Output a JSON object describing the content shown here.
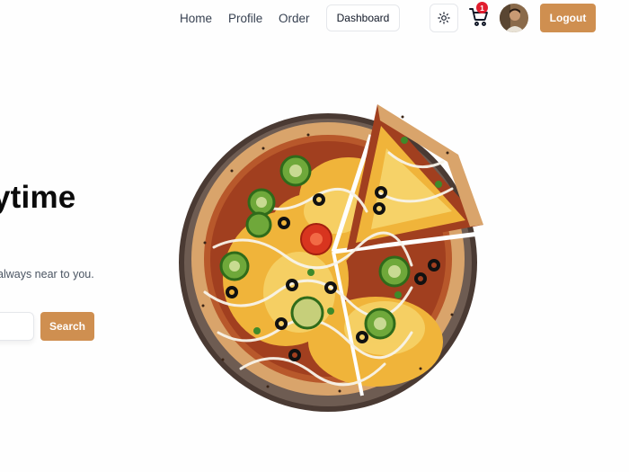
{
  "nav": {
    "links": [
      "Home",
      "Profile",
      "Order"
    ],
    "dashboard_label": "Dashboard",
    "theme_icon": "sun-icon",
    "cart_icon": "cart-icon",
    "cart_count": "1",
    "logout_label": "Logout"
  },
  "hero": {
    "headline": "ytime",
    "subtext": "always near to you.",
    "search_placeholder": "",
    "search_button_label": "Search",
    "image": "pizza-image"
  },
  "colors": {
    "accent": "#cf8f50",
    "badge": "#e11d2e"
  }
}
